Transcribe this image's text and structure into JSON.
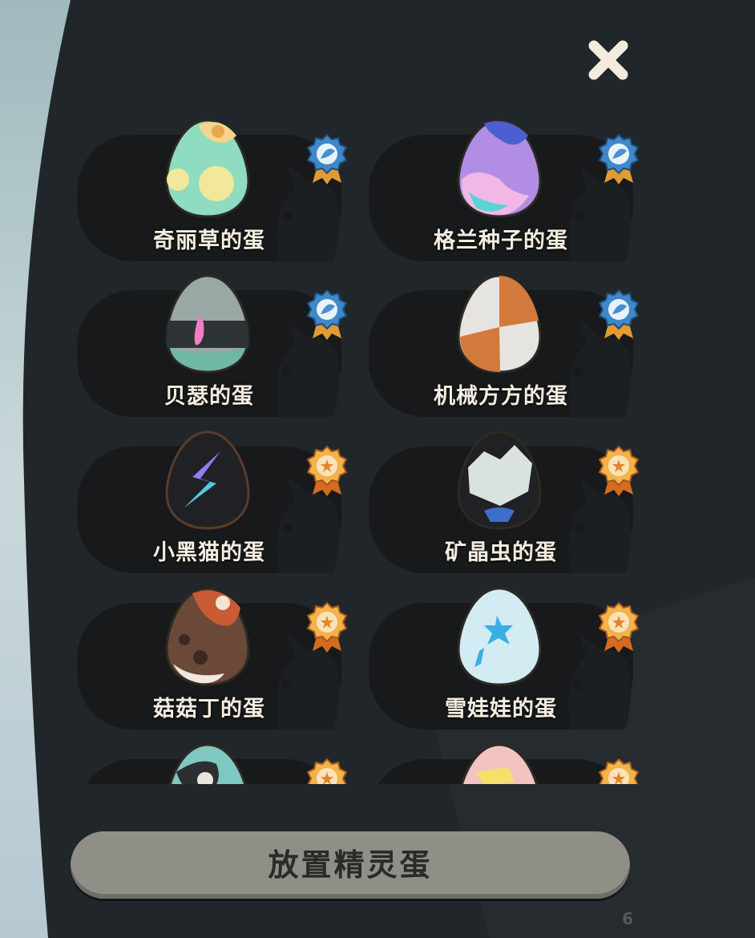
{
  "page": {
    "close_icon": "close-icon",
    "place_button_label": "放置精灵蛋",
    "uid_text": "6"
  },
  "colors": {
    "panel_bg": "#20262a",
    "card_bg": "#17191b",
    "button_bg": "#8f8f87",
    "label_text": "#f4ede0",
    "close_icon": "#f3ecdc"
  },
  "eggs": [
    {
      "name": "奇丽草的蛋",
      "badge": "blue-ribbon-badge-icon",
      "egg_icon": "mint-egg-icon"
    },
    {
      "name": "格兰种子的蛋",
      "badge": "blue-ribbon-badge-icon",
      "egg_icon": "purple-egg-icon"
    },
    {
      "name": "贝瑟的蛋",
      "badge": "blue-ribbon-badge-icon",
      "egg_icon": "gray-teal-egg-icon"
    },
    {
      "name": "机械方方的蛋",
      "badge": "blue-ribbon-badge-icon",
      "egg_icon": "orange-white-egg-icon"
    },
    {
      "name": "小黑猫的蛋",
      "badge": "orange-ribbon-badge-icon",
      "egg_icon": "black-bolt-egg-icon"
    },
    {
      "name": "矿晶虫的蛋",
      "badge": "orange-ribbon-badge-icon",
      "egg_icon": "crystal-egg-icon"
    },
    {
      "name": "菇菇丁的蛋",
      "badge": "orange-ribbon-badge-icon",
      "egg_icon": "mushroom-egg-icon"
    },
    {
      "name": "雪娃娃的蛋",
      "badge": "orange-ribbon-badge-icon",
      "egg_icon": "snow-egg-icon"
    },
    {
      "name": "",
      "badge": "orange-ribbon-badge-icon",
      "egg_icon": "teal-black-egg-icon"
    },
    {
      "name": "",
      "badge": "orange-ribbon-badge-icon",
      "egg_icon": "pink-egg-icon"
    }
  ]
}
